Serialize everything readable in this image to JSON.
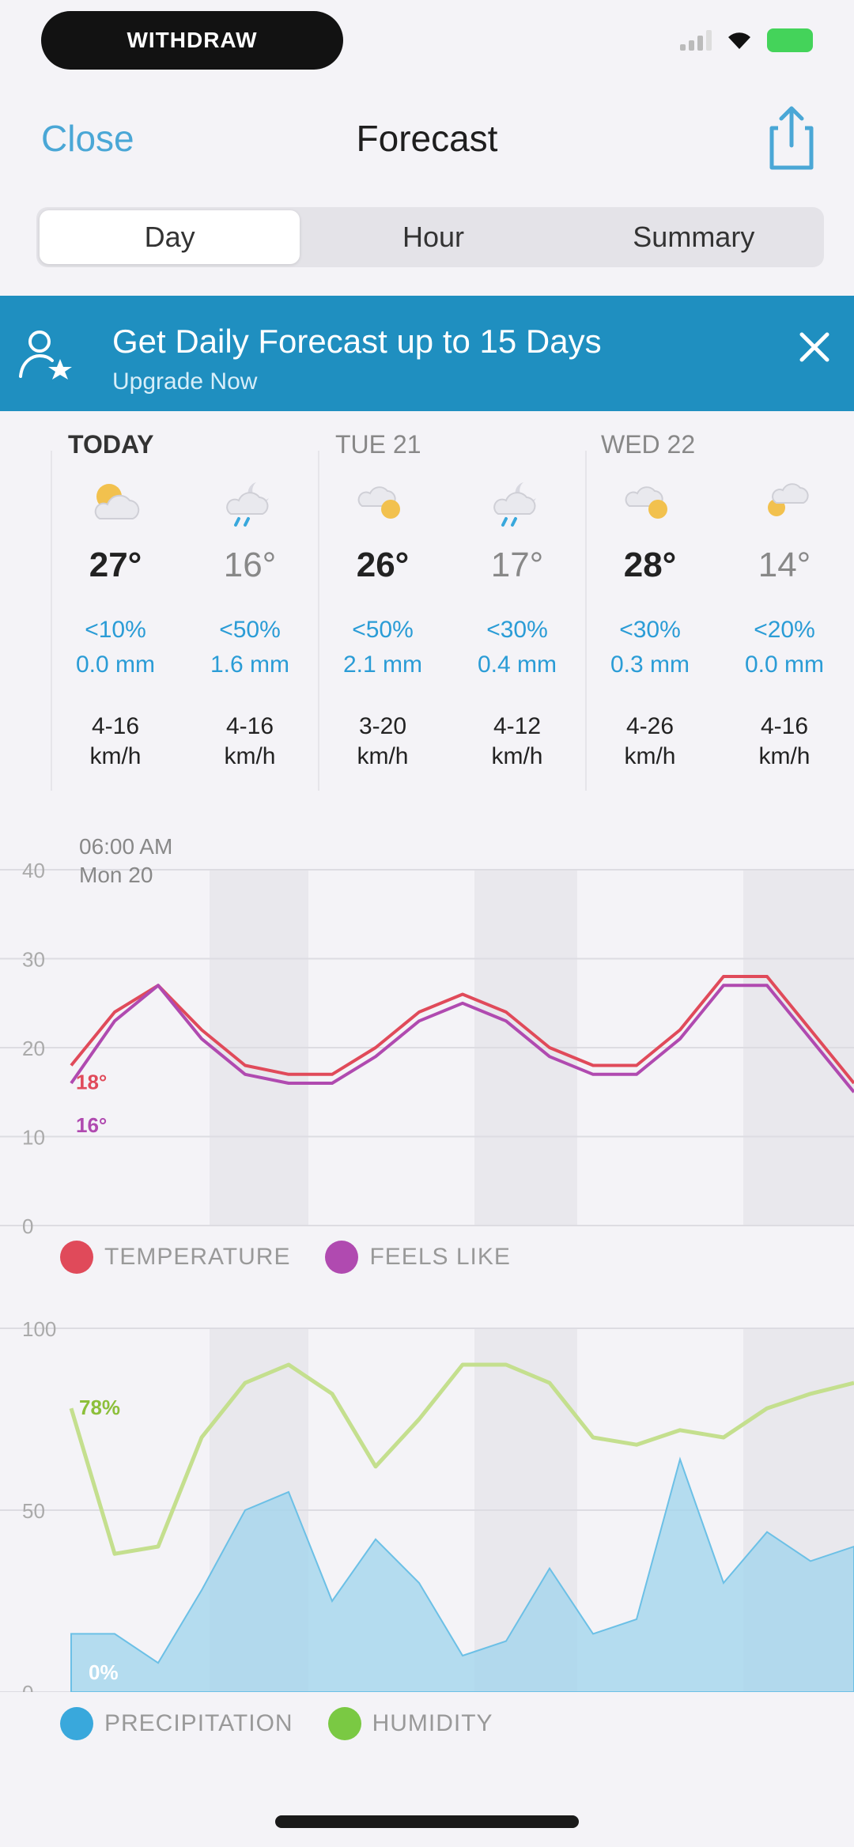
{
  "status": {
    "time_pill": "WITHDRAW"
  },
  "nav": {
    "close": "Close",
    "title": "Forecast"
  },
  "tabs": [
    {
      "label": "Day",
      "active": true
    },
    {
      "label": "Hour",
      "active": false
    },
    {
      "label": "Summary",
      "active": false
    }
  ],
  "banner": {
    "title": "Get Daily Forecast up to 15 Days",
    "subtitle": "Upgrade Now"
  },
  "days": [
    {
      "label": "TODAY"
    },
    {
      "label": "TUE 21"
    },
    {
      "label": "WED 22"
    }
  ],
  "periods": [
    {
      "icon": "partly-cloudy-day-icon",
      "temp": "27°",
      "low": false,
      "rain_chance": "<10%",
      "rain_amount": "0.0 mm",
      "wind_speed": "4-16",
      "wind_unit": "km/h"
    },
    {
      "icon": "cloudy-night-rain-icon",
      "temp": "16°",
      "low": true,
      "rain_chance": "<50%",
      "rain_amount": "1.6 mm",
      "wind_speed": "4-16",
      "wind_unit": "km/h"
    },
    {
      "icon": "sunny-cloud-icon",
      "temp": "26°",
      "low": false,
      "rain_chance": "<50%",
      "rain_amount": "2.1 mm",
      "wind_speed": "3-20",
      "wind_unit": "km/h"
    },
    {
      "icon": "cloudy-night-rain-icon",
      "temp": "17°",
      "low": true,
      "rain_chance": "<30%",
      "rain_amount": "0.4 mm",
      "wind_speed": "4-12",
      "wind_unit": "km/h"
    },
    {
      "icon": "sunny-cloud-icon",
      "temp": "28°",
      "low": false,
      "rain_chance": "<30%",
      "rain_amount": "0.3 mm",
      "wind_speed": "4-26",
      "wind_unit": "km/h"
    },
    {
      "icon": "night-cloud-icon",
      "temp": "14°",
      "low": true,
      "rain_chance": "<20%",
      "rain_amount": "0.0 mm",
      "wind_speed": "4-16",
      "wind_unit": "km/h"
    }
  ],
  "colors": {
    "accent": "#2a9cd6",
    "banner": "#1f8fc0",
    "temperature": "#e04a5a",
    "feels_like": "#b04ab0",
    "precipitation": "#39a8dc",
    "humidity": "#7ac943"
  },
  "chart_data": [
    {
      "type": "line",
      "title": "",
      "xlabel": "",
      "ylabel": "",
      "ylim": [
        0,
        40
      ],
      "y_ticks": [
        "0",
        "10",
        "20",
        "30",
        "40"
      ],
      "header_time": "06:00 AM",
      "header_date": "Mon 20",
      "current_labels": {
        "temperature": "18°",
        "feels_like": "16°"
      },
      "x": [
        0,
        4,
        8,
        12,
        16,
        20,
        24,
        28,
        32,
        36,
        40,
        44,
        48,
        52,
        56,
        60,
        64,
        68,
        72
      ],
      "series": [
        {
          "name": "TEMPERATURE",
          "values": [
            18,
            24,
            27,
            22,
            18,
            17,
            17,
            20,
            24,
            26,
            24,
            20,
            18,
            18,
            22,
            28,
            28,
            22,
            16
          ]
        },
        {
          "name": "FEELS LIKE",
          "values": [
            16,
            23,
            27,
            21,
            17,
            16,
            16,
            19,
            23,
            25,
            23,
            19,
            17,
            17,
            21,
            27,
            27,
            21,
            15
          ]
        }
      ],
      "legend": "bottom-left"
    },
    {
      "type": "area",
      "title": "",
      "xlabel": "",
      "ylabel": "",
      "ylim": [
        0,
        100
      ],
      "y_ticks": [
        "0",
        "50",
        "100"
      ],
      "current_labels": {
        "humidity": "78%",
        "precipitation": "0%"
      },
      "x": [
        0,
        4,
        8,
        12,
        16,
        20,
        24,
        28,
        32,
        36,
        40,
        44,
        48,
        52,
        56,
        60,
        64,
        68,
        72
      ],
      "series": [
        {
          "name": "HUMIDITY",
          "values": [
            78,
            38,
            40,
            70,
            85,
            90,
            82,
            62,
            75,
            90,
            90,
            85,
            70,
            68,
            72,
            70,
            78,
            82,
            85
          ]
        },
        {
          "name": "PRECIPITATION",
          "values": [
            16,
            16,
            8,
            28,
            50,
            55,
            25,
            42,
            30,
            10,
            14,
            34,
            16,
            20,
            64,
            30,
            44,
            36,
            40
          ]
        }
      ],
      "legend": "bottom-left"
    }
  ]
}
